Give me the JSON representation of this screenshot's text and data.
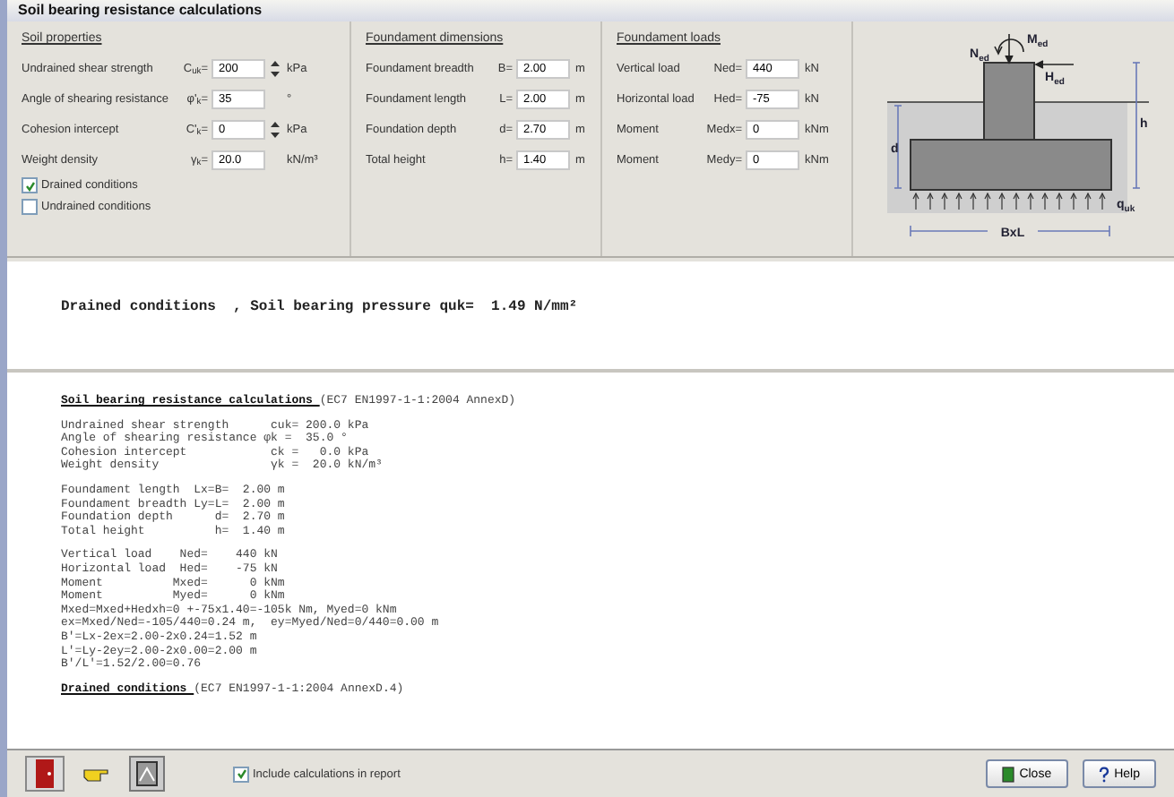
{
  "window": {
    "title": "Soil bearing resistance calculations"
  },
  "soil_properties": {
    "heading": "Soil properties",
    "fields": [
      {
        "label": "Undrained shear strength",
        "symbol": "C$_{uk}$=",
        "value": "200",
        "unit": "kPa",
        "spinner": true
      },
      {
        "label": "Angle of shearing resistance",
        "symbol": "φ'$_{k}$=",
        "value": "35",
        "unit": "°",
        "spinner": false
      },
      {
        "label": "Cohesion intercept",
        "symbol": "C'$_{k}$=",
        "value": "0",
        "unit": "kPa",
        "spinner": true
      },
      {
        "label": "Weight density",
        "symbol": "γ$_{k}$=",
        "value": "20.0",
        "unit": "kN/m³",
        "spinner": false
      }
    ],
    "options": [
      {
        "label": "Drained conditions",
        "checked": true
      },
      {
        "label": "Undrained conditions",
        "checked": false
      }
    ]
  },
  "foundament_dimensions": {
    "heading": "Foundament dimensions",
    "fields": [
      {
        "label": "Foundament breadth",
        "symbol": "B=",
        "value": "2.00",
        "unit": "m"
      },
      {
        "label": "Foundament length",
        "symbol": "L=",
        "value": "2.00",
        "unit": "m"
      },
      {
        "label": "Foundation depth",
        "symbol": "d=",
        "value": "2.70",
        "unit": "m"
      },
      {
        "label": "Total height",
        "symbol": "h=",
        "value": "1.40",
        "unit": "m"
      }
    ]
  },
  "foundament_loads": {
    "heading": "Foundament loads",
    "fields": [
      {
        "label": "Vertical load",
        "symbol": "Ned=",
        "value": "440",
        "unit": "kN"
      },
      {
        "label": "Horizontal load",
        "symbol": "Hed=",
        "value": "-75",
        "unit": "kN"
      },
      {
        "label": "Moment",
        "symbol": "Medx=",
        "value": "0",
        "unit": "kNm"
      },
      {
        "label": "Moment",
        "symbol": "Medy=",
        "value": "0",
        "unit": "kNm"
      }
    ]
  },
  "diagram": {
    "moment": "M$_{ed}$",
    "axial": "N$_{ed}$",
    "horizontal": "H$_{ed}$",
    "height": "h",
    "depth": "d",
    "pressure": "q$_{uk}$",
    "base": "BxL"
  },
  "result": "Drained conditions  , Soil bearing pressure quk=  1.49 N/mm²",
  "report": [
    {
      "kind": "heading",
      "title": "Soil bearing resistance calculations ",
      "ref": "(EC7 EN1997-1-1:2004 AnnexD)"
    },
    {
      "kind": "lines",
      "lines": [
        "Undrained shear strength      cuk= 200.0 kPa",
        "Angle of shearing resistance φk =  35.0 °",
        "Cohesion intercept            ck =   0.0 kPa",
        "Weight density                γk =  20.0 kN/m³"
      ]
    },
    {
      "kind": "lines",
      "lines": [
        "Foundament length  Lx=B=  2.00 m",
        "Foundament breadth Ly=L=  2.00 m",
        "Foundation depth      d=  2.70 m",
        "Total height          h=  1.40 m"
      ]
    },
    {
      "kind": "lines",
      "lines": [
        "Vertical load    Ned=    440 kN",
        "Horizontal load  Hed=    -75 kN",
        "Moment          Mxed=      0 kNm",
        "Moment          Myed=      0 kNm",
        "Mxed=Mxed+Hedxh=0 +-75x1.40=-105k Nm, Myed=0 kNm",
        "ex=Mxed/Ned=-105/440=0.24 m,  ey=Myed/Ned=0/440=0.00 m",
        "B'=Lx-2ex=2.00-2x0.24=1.52 m",
        "L'=Ly-2ey=2.00-2x0.00=2.00 m",
        "B'/L'=1.52/2.00=0.76"
      ]
    },
    {
      "kind": "heading",
      "title": "Drained conditions ",
      "ref": "(EC7 EN1997-1-1:2004 AnnexD.4)"
    }
  ],
  "footer": {
    "include": {
      "label": "Include calculations in report",
      "checked": true
    },
    "buttons": [
      {
        "kind": "close",
        "label": "Close"
      },
      {
        "kind": "help",
        "label": "Help"
      }
    ]
  }
}
